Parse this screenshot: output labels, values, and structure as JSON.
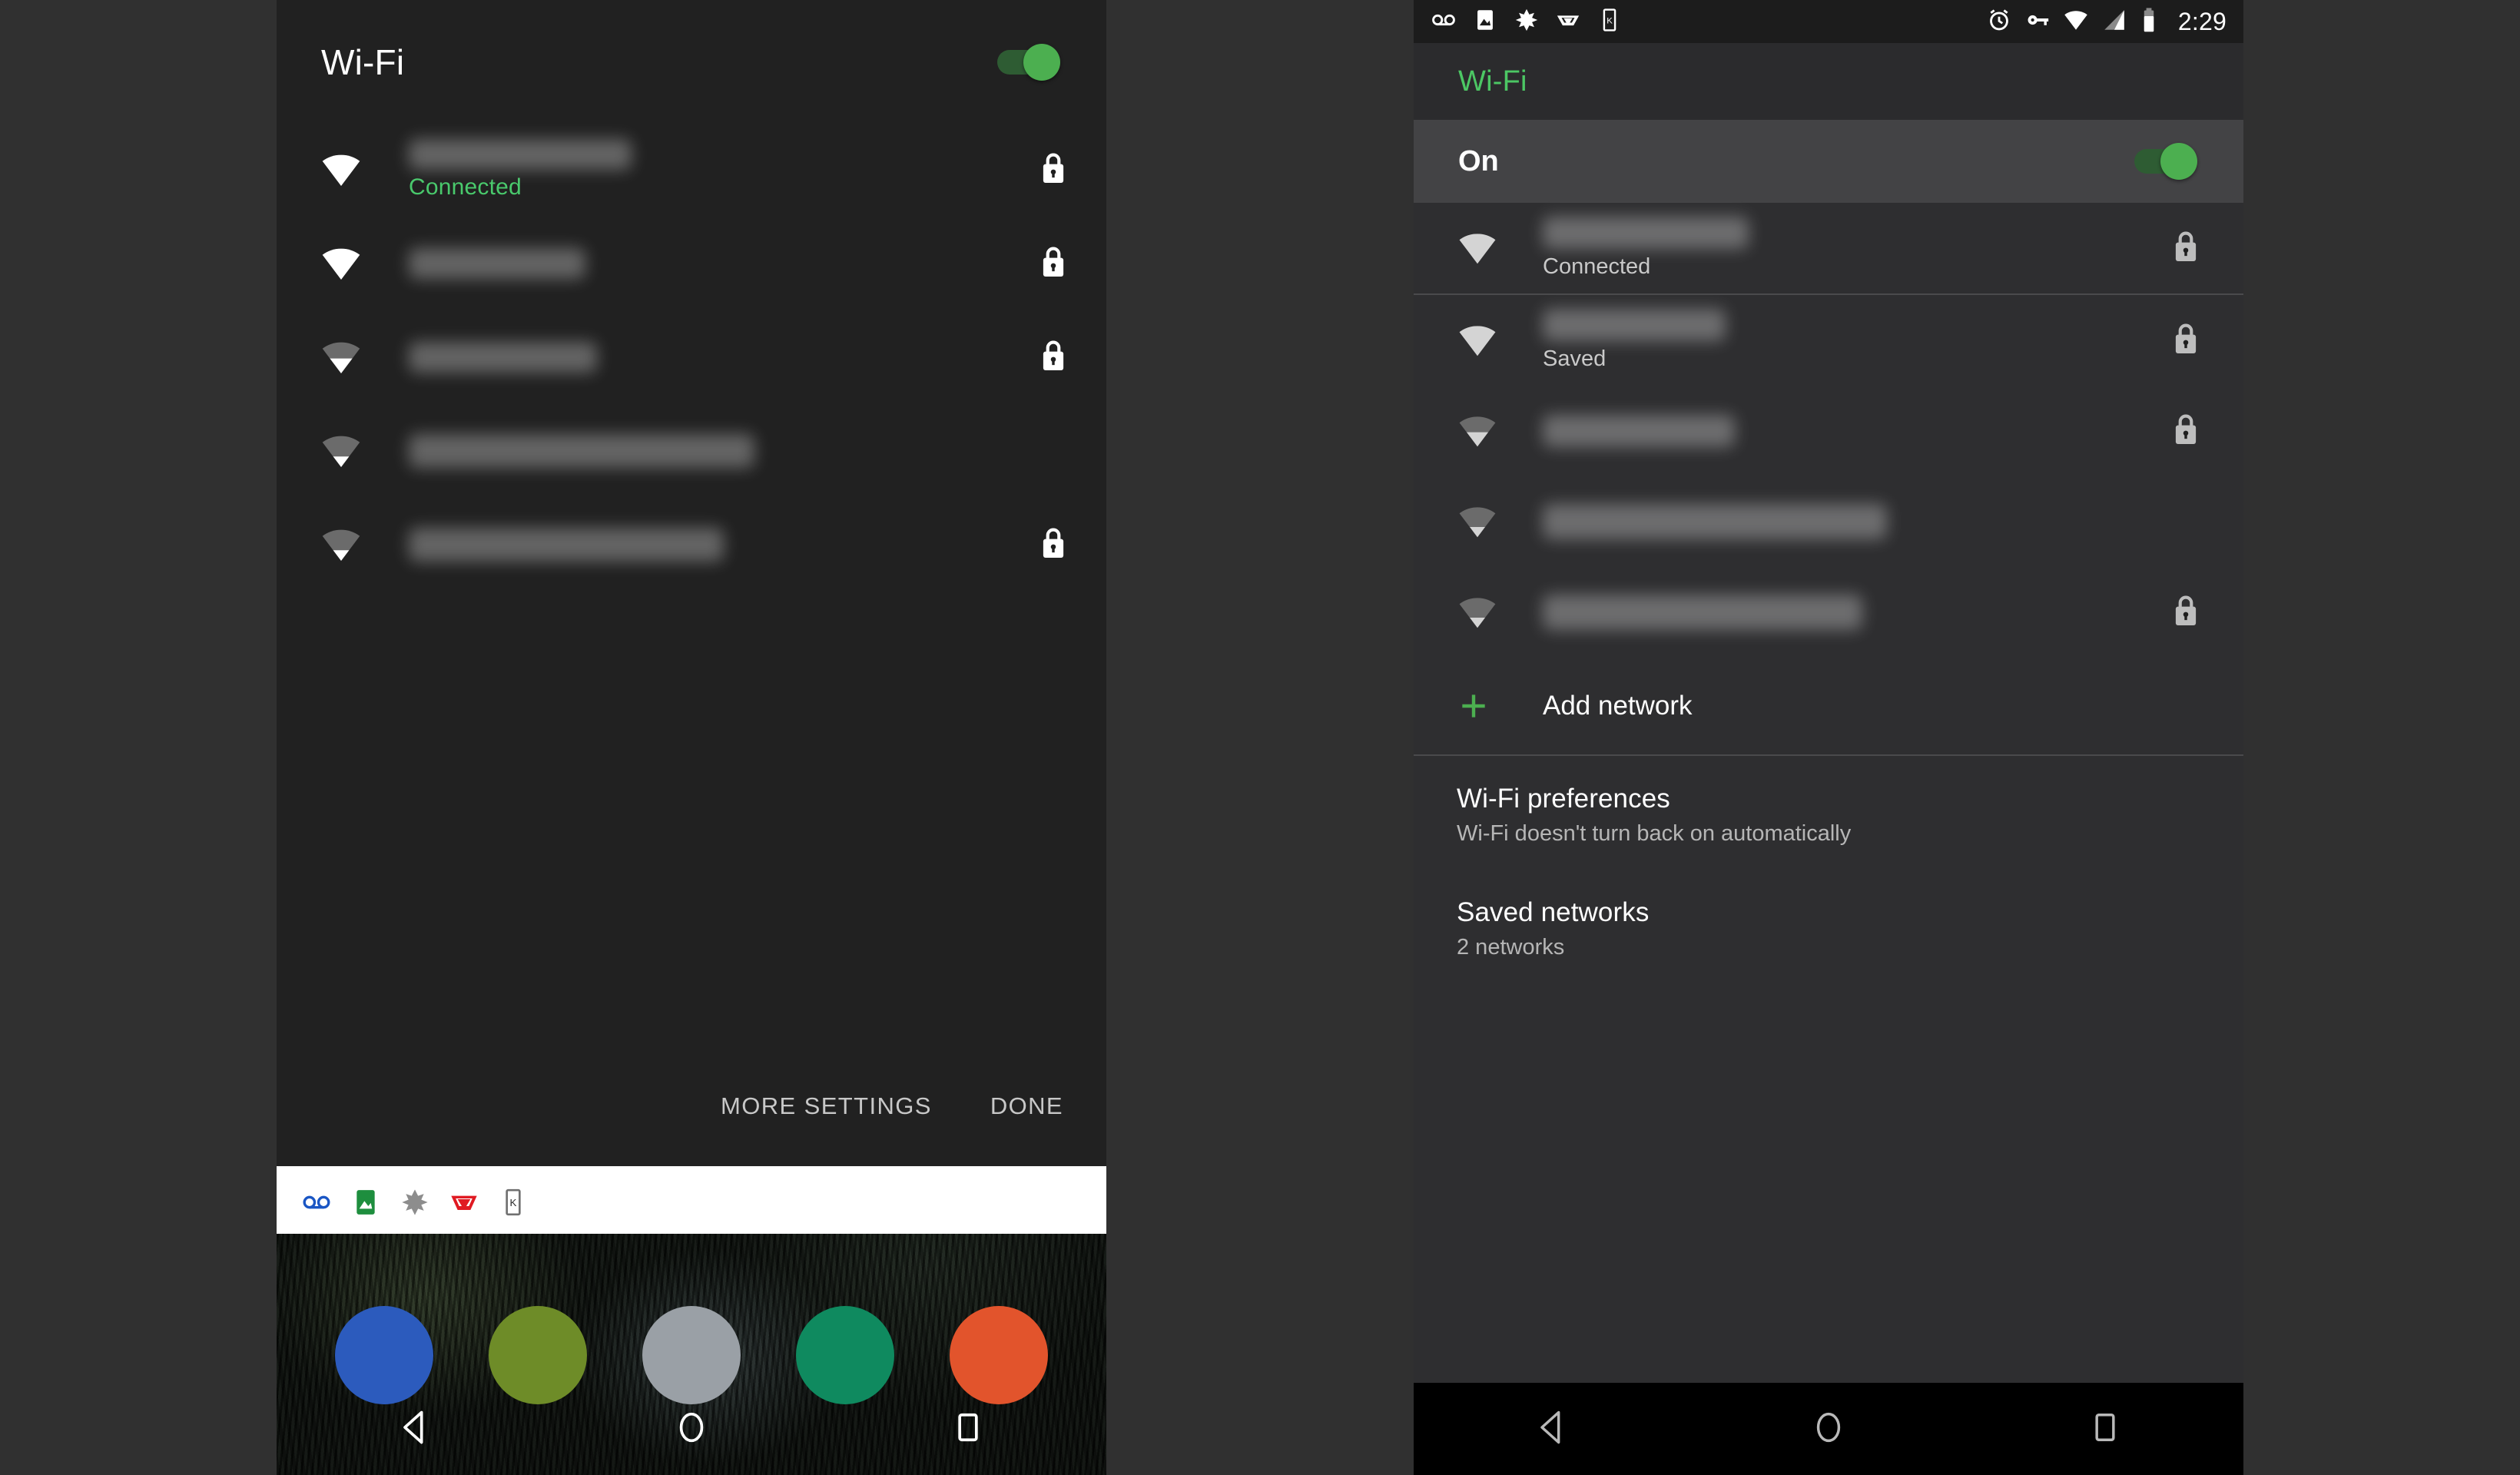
{
  "left_panel": {
    "name": "quick-settings-wifi-detail",
    "title": "Wi-Fi",
    "wifi_enabled": true,
    "networks": [
      {
        "name_redacted": true,
        "status": "Connected",
        "status_color": "#49c96c",
        "signal": 4,
        "secured": true,
        "name_w": 290,
        "name_h": 40
      },
      {
        "name_redacted": true,
        "status": "",
        "status_color": "",
        "signal": 4,
        "secured": true,
        "name_w": 230,
        "name_h": 40
      },
      {
        "name_redacted": true,
        "status": "",
        "status_color": "",
        "signal": 2,
        "secured": true,
        "name_w": 245,
        "name_h": 40
      },
      {
        "name_redacted": true,
        "status": "",
        "status_color": "",
        "signal": 1,
        "secured": false,
        "name_w": 450,
        "name_h": 44
      },
      {
        "name_redacted": true,
        "status": "",
        "status_color": "",
        "signal": 1,
        "secured": true,
        "name_w": 410,
        "name_h": 44
      }
    ],
    "actions": {
      "more_settings": "MORE SETTINGS",
      "done": "DONE"
    },
    "shade_icons": [
      "voicemail-icon",
      "photos-icon",
      "leaf-icon",
      "v-logo-icon",
      "kindle-icon"
    ],
    "home_app_icons": [
      "#2c5bbd",
      "#6e8c28",
      "#9aa0a6",
      "#0f8a5f",
      "#e2542c"
    ],
    "nav": {
      "back": "back-icon",
      "home": "home-icon",
      "recents": "recents-icon"
    }
  },
  "right_panel": {
    "name": "settings-wifi-screen",
    "statusbar": {
      "time": "2:29",
      "left_icons": [
        "voicemail-icon",
        "photos-icon",
        "leaf-icon",
        "v-logo-icon",
        "kindle-icon"
      ],
      "right_icons": [
        "alarm-icon",
        "vpn-key-icon",
        "wifi-icon",
        "signal-icon",
        "battery-icon"
      ]
    },
    "appbar_title": "Wi-Fi",
    "appbar_title_color": "#4cc764",
    "on_row": {
      "label": "On",
      "enabled": true
    },
    "networks": [
      {
        "name_redacted": true,
        "status": "Connected",
        "signal": 4,
        "secured": true,
        "name_w": 268,
        "name_h": 42
      },
      {
        "name_redacted": true,
        "status": "Saved",
        "signal": 4,
        "secured": true,
        "name_w": 238,
        "name_h": 42
      },
      {
        "name_redacted": true,
        "status": "",
        "signal": 2,
        "secured": true,
        "name_w": 250,
        "name_h": 42
      },
      {
        "name_redacted": true,
        "status": "",
        "signal": 1,
        "secured": false,
        "name_w": 448,
        "name_h": 46
      },
      {
        "name_redacted": true,
        "status": "",
        "signal": 1,
        "secured": true,
        "name_w": 416,
        "name_h": 46
      }
    ],
    "add_network": {
      "label": "Add network",
      "icon": "plus-icon",
      "icon_color": "#4caf50"
    },
    "preferences": [
      {
        "title": "Wi-Fi preferences",
        "subtitle": "Wi-Fi doesn't turn back on automatically"
      },
      {
        "title": "Saved networks",
        "subtitle": "2 networks"
      }
    ],
    "nav": {
      "back": "back-icon",
      "home": "home-icon",
      "recents": "recents-icon"
    }
  },
  "colors": {
    "page_bg": "#303030",
    "qs_panel_bg": "#212121",
    "right_panel_bg": "#2e2e30",
    "accent_green": "#4caf50",
    "connected_green": "#49c96c",
    "on_row_bg": "#434345"
  }
}
